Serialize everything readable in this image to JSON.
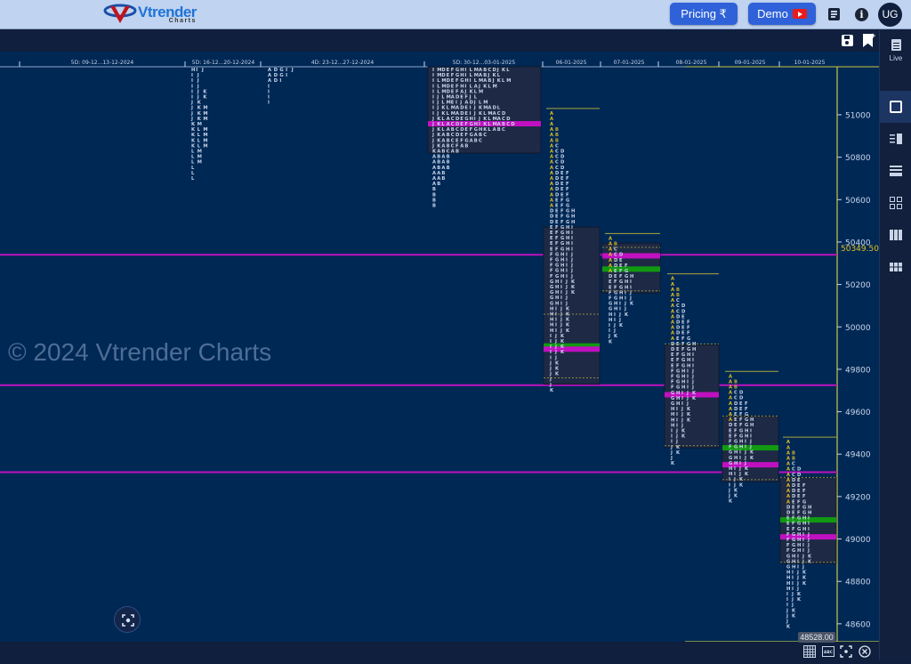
{
  "header": {
    "logo_title": "Vtrender",
    "logo_sub": "Charts",
    "pricing_label": "Pricing ₹",
    "demo_label": "Demo",
    "avatar_initials": "UG",
    "icons": [
      "notes-icon",
      "info-icon"
    ]
  },
  "toolbar": {
    "icons": [
      "save-icon",
      "bookmark-add-icon"
    ]
  },
  "sidebar": {
    "live_label": "Live",
    "layouts": [
      "single-layout",
      "split-side-layout",
      "rows-layout",
      "grid-2x2-layout",
      "columns-3-layout",
      "grid-3x2-layout"
    ]
  },
  "watermark": "© 2024 Vtrender Charts",
  "price_tag": "48528.00",
  "colors": {
    "background": "#002855",
    "poc": "#c010c0",
    "value_area_green": "#119911",
    "profile_box": "#1e2a45",
    "axis_line": "#c8c840",
    "letter": "#c9d6ea",
    "a_period": "#e0c020"
  },
  "chart_data": {
    "type": "market-profile",
    "title": "",
    "ylabel": "Price",
    "ylim": [
      48528,
      51130
    ],
    "yticks": [
      51000,
      50800,
      50600,
      50400,
      50200,
      50000,
      49800,
      49600,
      49400,
      49200,
      49000,
      48800,
      48600
    ],
    "last_price_label": "50349.50",
    "current_price": 48528.0,
    "periods": [
      {
        "label": "5D: 09-12...13-12-2024"
      },
      {
        "label": "5D: 16-12...20-12-2024",
        "profile_top_rows": [
          "HI J",
          "I J",
          "I J",
          "I J",
          "I J K",
          "I J K",
          "J K",
          "J K M",
          "J K M",
          "J K M",
          "K M",
          "K L M",
          "K L M",
          "K L M",
          "K L M",
          "L M",
          "L M",
          "L M",
          "L",
          "L",
          "L"
        ]
      },
      {
        "label": "4D: 23-12...27-12-2024",
        "profile_top_rows": [
          "A D G I J",
          "A D G I",
          "A D I",
          "I",
          "I",
          "I",
          "I"
        ]
      },
      {
        "label": "5D: 30-12...03-01-2025",
        "profile_top_rows": [
          "I M D E F G H I L M A B C D J K L",
          "I M D E F G H I L M A B J K L",
          "I L M D E F G H I L M A B J K L M",
          "I L M D E F H I L A J K L M",
          "I L M D E F A J K L M",
          "I J L M A D E F J L",
          "I J L M E I J A D J L M",
          "I J K L M A D E I J K M A D L",
          "I J K L M A D E I J K L M A C D",
          "J K L A C D E G H I J K L M A C D",
          "J K L A C D E F G H I K L M A B C D",
          "J K L A B C D E F G H K L A B C",
          "J K A B C D E F G A B C",
          "J K A B C E F G A B C",
          "J K A B C F A B",
          "K A B C A B",
          "A B A B",
          "A B A B",
          "A B A B",
          "A A B",
          "A A B",
          "A B",
          "B",
          "B",
          "B",
          "B"
        ],
        "poc_row": 10
      },
      {
        "label": "06-01-2025",
        "high": 51030,
        "low": 49730,
        "poc": 49895,
        "vah": 50060,
        "val": 49760
      },
      {
        "label": "07-01-2025",
        "high": 50440,
        "low": 49960,
        "poc": 50335,
        "vah": 50375,
        "val": 50170
      },
      {
        "label": "08-01-2025",
        "high": 50250,
        "low": 49370,
        "poc": 49680,
        "vah": 49920,
        "val": 49440
      },
      {
        "label": "09-01-2025",
        "high": 49790,
        "low": 49210,
        "poc": 49350,
        "vah": 49580,
        "val": 49280
      },
      {
        "label": "10-01-2025",
        "high": 49480,
        "low": 48620,
        "poc": 49010,
        "vah": 49290,
        "val": 48890
      }
    ],
    "horizontal_lines": [
      {
        "name": "poc-line-1",
        "price": 50340
      },
      {
        "name": "poc-line-2",
        "price": 49725
      },
      {
        "name": "poc-line-3",
        "price": 49315
      }
    ]
  }
}
